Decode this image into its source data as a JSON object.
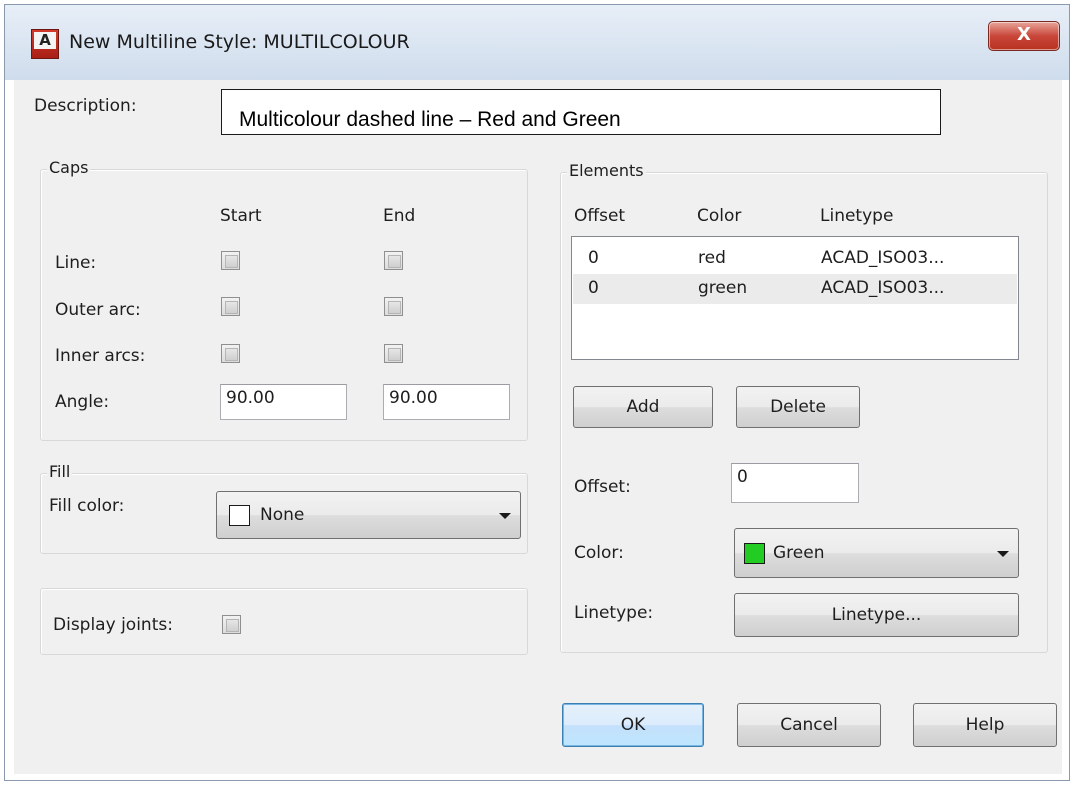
{
  "window": {
    "app_icon": "autocad-a-icon",
    "app_icon_letter": "A",
    "title": "New Multiline Style: MULTILCOLOUR",
    "close_glyph": "X"
  },
  "description": {
    "label": "Description:",
    "value": "Multicolour dashed line – Red and Green"
  },
  "caps": {
    "title": "Caps",
    "col_start": "Start",
    "col_end": "End",
    "rows": [
      {
        "label": "Line:",
        "start_checked": false,
        "end_checked": false
      },
      {
        "label": "Outer arc:",
        "start_checked": false,
        "end_checked": false
      },
      {
        "label": "Inner arcs:",
        "start_checked": false,
        "end_checked": false
      }
    ],
    "angle_label": "Angle:",
    "angle_start": "90.00",
    "angle_end": "90.00"
  },
  "fill": {
    "title": "Fill",
    "color_label": "Fill color:",
    "color_value": "None",
    "swatch_color": "#ffffff"
  },
  "display_joints": {
    "label": "Display joints:",
    "checked": false
  },
  "elements": {
    "title": "Elements",
    "columns": [
      "Offset",
      "Color",
      "Linetype"
    ],
    "rows": [
      {
        "offset": "0",
        "color": "red",
        "linetype": "ACAD_ISO03...",
        "selected": false
      },
      {
        "offset": "0",
        "color": "green",
        "linetype": "ACAD_ISO03...",
        "selected": true
      }
    ],
    "add_label": "Add",
    "delete_label": "Delete",
    "offset_label": "Offset:",
    "offset_value": "0",
    "color_label": "Color:",
    "color_value": "Green",
    "color_swatch": "#22cc22",
    "linetype_label": "Linetype:",
    "linetype_button": "Linetype..."
  },
  "buttons": {
    "ok": "OK",
    "cancel": "Cancel",
    "help": "Help"
  }
}
